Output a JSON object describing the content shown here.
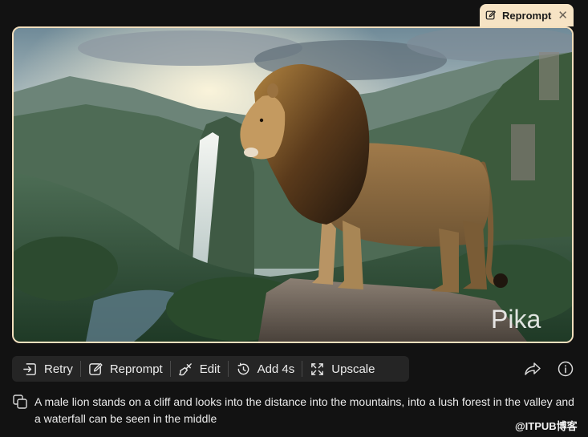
{
  "tab": {
    "label": "Reprompt",
    "icon": "edit-icon",
    "close": "✕"
  },
  "video": {
    "brand_watermark": "Pika",
    "border_color": "#f3dfbd"
  },
  "toolbar": {
    "buttons": [
      {
        "label": "Retry",
        "icon": "retry-icon"
      },
      {
        "label": "Reprompt",
        "icon": "edit-icon"
      },
      {
        "label": "Edit",
        "icon": "brush-icon"
      },
      {
        "label": "Add 4s",
        "icon": "timer-add-icon"
      },
      {
        "label": "Upscale",
        "icon": "expand-icon"
      }
    ],
    "share_icon": "share-icon",
    "info_icon": "info-icon"
  },
  "prompt": {
    "text": "A male lion stands on a cliff and looks into the distance into the mountains, into a lush forest in the valley and a waterfall can be seen in the middle",
    "copy_icon": "copy-icon"
  },
  "watermark": "@ITPUB博客",
  "colors": {
    "background": "#121212",
    "accent": "#f6e3c4",
    "toolbar": "#252525"
  }
}
